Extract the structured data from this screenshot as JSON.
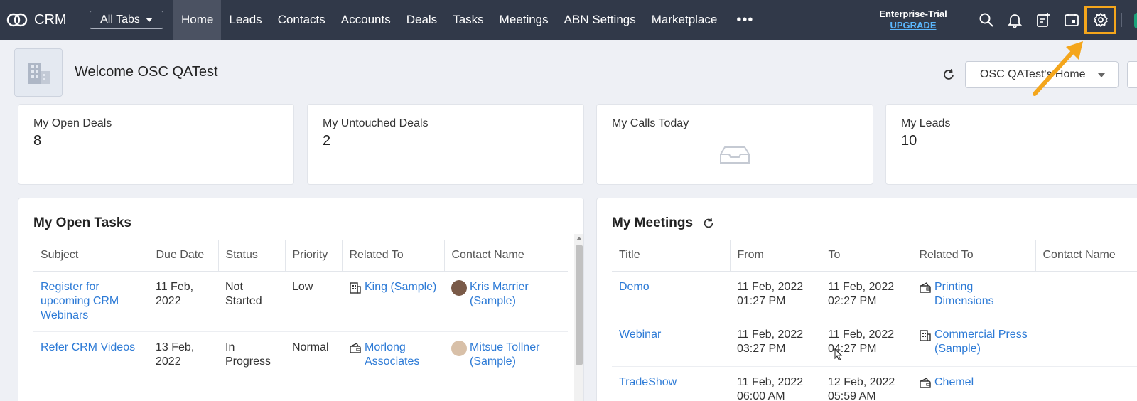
{
  "topbar": {
    "app_name": "CRM",
    "all_tabs_label": "All Tabs",
    "nav_items": [
      "Home",
      "Leads",
      "Contacts",
      "Accounts",
      "Deals",
      "Tasks",
      "Meetings",
      "ABN Settings",
      "Marketplace"
    ],
    "more_label": "•••",
    "plan": "Enterprise-Trial",
    "upgrade_label": "UPGRADE",
    "icons": [
      "search-icon",
      "bell-icon",
      "add-note-icon",
      "calendar-icon",
      "settings-icon"
    ],
    "highlight_color": "#f4a61c"
  },
  "welcome": {
    "greeting": "Welcome OSC QATest",
    "home_select": "OSC QATest's Home"
  },
  "kpis": [
    {
      "label": "My Open Deals",
      "value": "8"
    },
    {
      "label": "My Untouched Deals",
      "value": "2"
    },
    {
      "label": "My Calls Today",
      "value": ""
    },
    {
      "label": "My Leads",
      "value": "10"
    }
  ],
  "tasks": {
    "title": "My Open Tasks",
    "columns": [
      "Subject",
      "Due Date",
      "Status",
      "Priority",
      "Related To",
      "Contact Name"
    ],
    "rows": [
      {
        "subject": "Register for upcoming CRM Webinars",
        "due": "11 Feb, 2022",
        "status": "Not Started",
        "priority": "Low",
        "related": "King (Sample)",
        "related_icon": "account-icon",
        "contact": "Kris Marrier (Sample)"
      },
      {
        "subject": "Refer CRM Videos",
        "due": "13 Feb, 2022",
        "status": "In Progress",
        "priority": "Normal",
        "related": "Morlong Associates",
        "related_icon": "deal-icon",
        "contact": "Mitsue Tollner (Sample)"
      }
    ]
  },
  "meetings": {
    "title": "My Meetings",
    "columns": [
      "Title",
      "From",
      "To",
      "Related To",
      "Contact Name"
    ],
    "rows": [
      {
        "title": "Demo",
        "from": "11 Feb, 2022 01:27 PM",
        "to": "11 Feb, 2022 02:27 PM",
        "related": "Printing Dimensions",
        "related_icon": "deal-icon"
      },
      {
        "title": "Webinar",
        "from": "11 Feb, 2022 03:27 PM",
        "to": "11 Feb, 2022 04:27 PM",
        "related": "Commercial Press (Sample)",
        "related_icon": "account-icon"
      },
      {
        "title": "TradeShow",
        "from": "11 Feb, 2022 06:00 AM",
        "to": "12 Feb, 2022 05:59 AM",
        "related": "Chemel",
        "related_icon": "deal-icon"
      }
    ]
  }
}
